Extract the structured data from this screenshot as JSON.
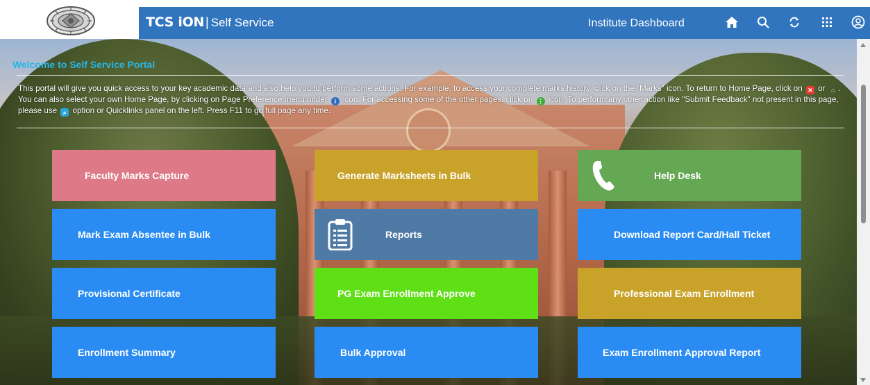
{
  "header": {
    "brand_main": "TCS iON",
    "brand_separator": "|",
    "brand_sub": "Self Service",
    "dashboard_title": "Institute Dashboard",
    "bg_color": "#3175bf",
    "icons": [
      "home-icon",
      "search-icon",
      "refresh-icon",
      "apps-grid-icon",
      "user-account-icon"
    ]
  },
  "welcome": {
    "title": "Welcome to Self Service Portal",
    "title_color": "#29b6e8",
    "text_1": "This portal will give you quick access to your key academic data and also help you to perform some actions. For example, to access your complete marks history, click on the \"Marks\" icon. To return to Home Page, click on",
    "text_2": "or",
    "text_3": ". You can also select your own Home Page, by clicking on Page Preference menu under",
    "text_4": "icon. For accessing some of the other pages, click on",
    "text_5": "icon. To perform any other action like \"Submit Feedback\" not present in this page, please use",
    "text_6": "option or Quicklinks panel on the left. Press F11 to go full page any time."
  },
  "tiles": [
    {
      "label": "Faculty Marks Capture",
      "color": "#de7a87"
    },
    {
      "label": "Generate Marksheets in Bulk",
      "color": "#c9a22a"
    },
    {
      "label": "Help Desk",
      "color": "#65a853",
      "icon": "phone-icon"
    },
    {
      "label": "Mark Exam Absentee in Bulk",
      "color": "#2a8cf2"
    },
    {
      "label": "Reports",
      "color": "#4f7aa5",
      "icon": "clipboard-report-icon"
    },
    {
      "label": "Download Report Card/Hall Ticket",
      "color": "#2a8cf2"
    },
    {
      "label": "Provisional Certificate",
      "color": "#2a8cf2"
    },
    {
      "label": "PG Exam Enrollment Approve",
      "color": "#5fe016"
    },
    {
      "label": "Professional Exam Enrollment",
      "color": "#c9a22a"
    },
    {
      "label": "Enrollment Summary",
      "color": "#2a8cf2"
    },
    {
      "label": "Bulk Approval",
      "color": "#2a8cf2"
    },
    {
      "label": "Exam Enrollment Approval Report",
      "color": "#2a8cf2"
    }
  ]
}
